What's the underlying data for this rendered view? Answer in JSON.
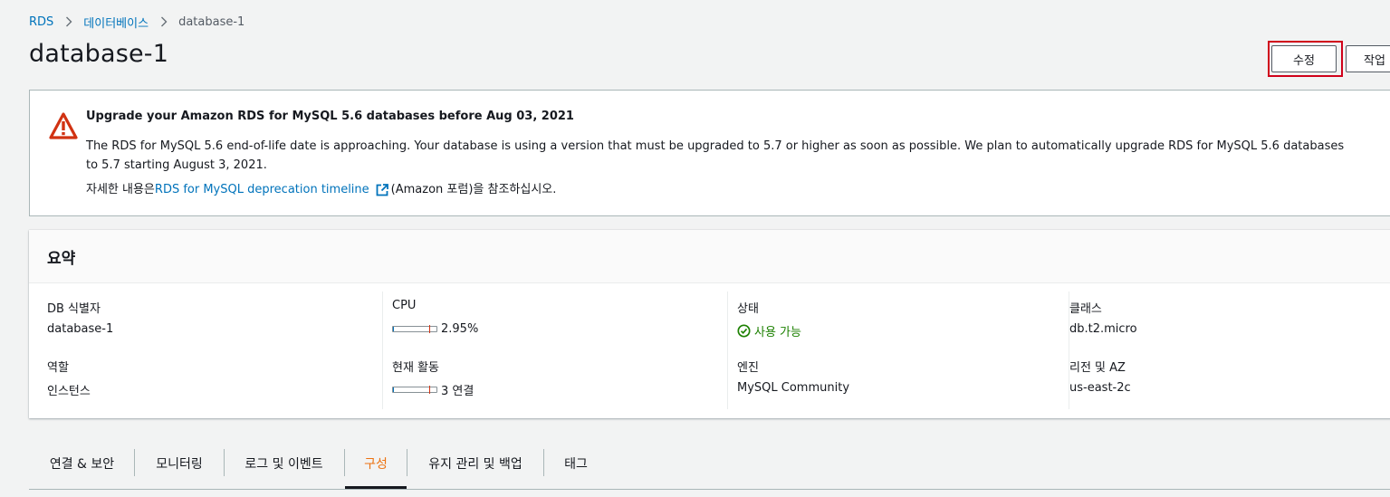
{
  "breadcrumb": {
    "items": [
      "RDS",
      "데이터베이스"
    ],
    "current": "database-1"
  },
  "page": {
    "title": "database-1"
  },
  "actions": {
    "modify_label": "수정",
    "actions_label": "작업"
  },
  "alert": {
    "title": "Upgrade your Amazon RDS for MySQL 5.6 databases before Aug 03, 2021",
    "body": "The RDS for MySQL 5.6 end-of-life date is approaching. Your database is using a version that must be upgraded to 5.7 or higher as soon as possible. We plan to automatically upgrade RDS for MySQL 5.6 databases to 5.7 starting August 3, 2021.",
    "more_prefix": "자세한 내용은",
    "more_link": "RDS for MySQL deprecation timeline",
    "more_suffix": "(Amazon 포럼)을 참조하십시오.",
    "icon": "warning-icon",
    "icon_color": "#d13212"
  },
  "summary": {
    "title": "요약",
    "db_identifier_label": "DB 식별자",
    "db_identifier_value": "database-1",
    "role_label": "역할",
    "role_value": "인스턴스",
    "cpu_label": "CPU",
    "cpu_value": "2.95%",
    "cpu_fraction": 0.0295,
    "activity_label": "현재 활동",
    "activity_value": "3 연결",
    "activity_fraction": 0.03,
    "status_label": "상태",
    "status_value": "사용 가능",
    "status_color": "#1d8102",
    "engine_label": "엔진",
    "engine_value": "MySQL Community",
    "class_label": "클래스",
    "class_value": "db.t2.micro",
    "region_label": "리전 및 AZ",
    "region_value": "us-east-2c"
  },
  "tabs": [
    {
      "label": "연결 & 보안",
      "active": false
    },
    {
      "label": "모니터링",
      "active": false
    },
    {
      "label": "로그 및 이벤트",
      "active": false
    },
    {
      "label": "구성",
      "active": true
    },
    {
      "label": "유지 관리 및 백업",
      "active": false
    },
    {
      "label": "태그",
      "active": false
    }
  ],
  "colors": {
    "link": "#0073bb",
    "active_tab": "#ec7211",
    "highlight": "#d0021b"
  }
}
